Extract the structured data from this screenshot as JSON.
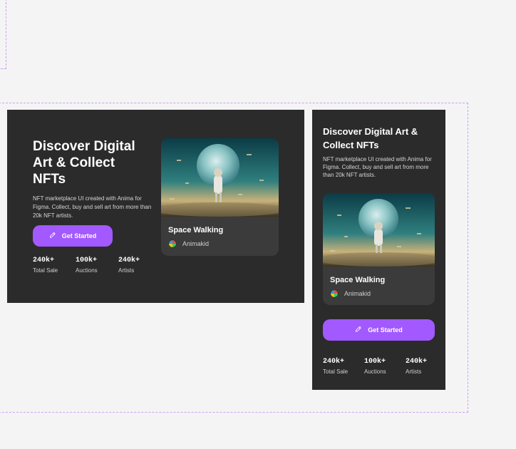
{
  "hero": {
    "title": "Discover Digital Art & Collect NFTs",
    "description": "NFT marketplace UI created with Anima for Figma. Collect, buy and sell art from more than 20k NFT artists.",
    "cta_label": "Get Started",
    "stats": [
      {
        "value": "240k+",
        "label": "Total Sale"
      },
      {
        "value": "100k+",
        "label": "Auctions"
      },
      {
        "value": "240k+",
        "label": "Artists"
      }
    ],
    "card": {
      "title": "Space Walking",
      "artist": "Animakid"
    }
  },
  "colors": {
    "background": "#f4f4f5",
    "panel": "#2b2b2b",
    "card": "#3b3b3b",
    "accent": "#a259ff"
  },
  "icons": {
    "cta": "rocket-icon",
    "artist": "avatar"
  }
}
